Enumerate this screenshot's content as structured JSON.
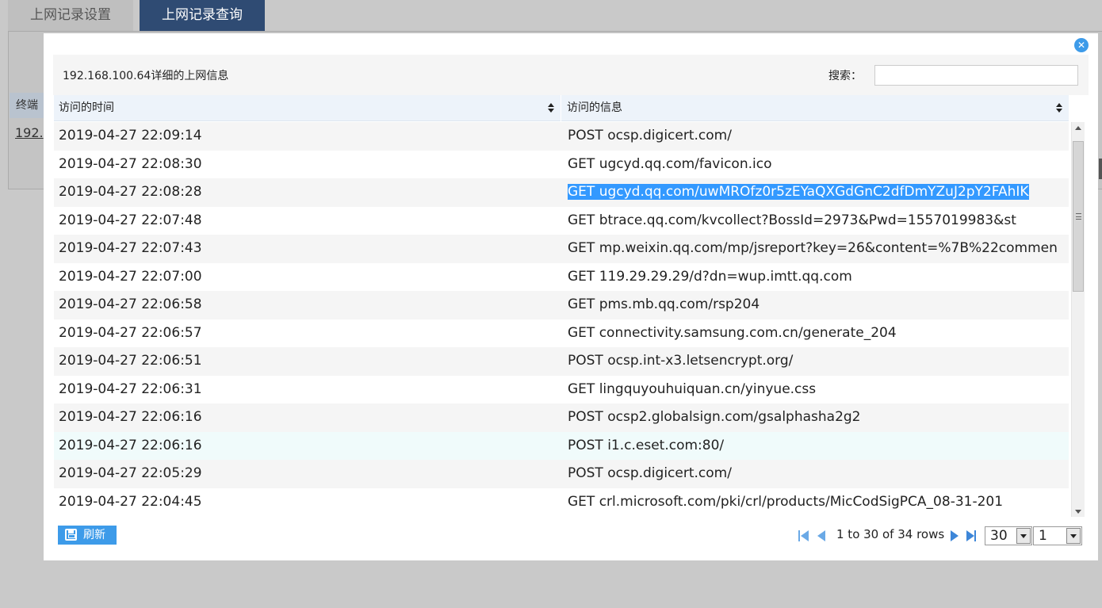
{
  "tabs": [
    {
      "label": "上网记录设置",
      "active": false
    },
    {
      "label": "上网记录查询",
      "active": true
    }
  ],
  "background": {
    "column_header": "终端",
    "ip_link": "192."
  },
  "modal": {
    "close_icon": "close-icon",
    "title": "192.168.100.64详细的上网信息",
    "search": {
      "label": "搜索：",
      "value": "",
      "placeholder": ""
    },
    "columns": [
      "访问的时间",
      "访问的信息"
    ],
    "rows": [
      {
        "time": "2019-04-27 22:09:14",
        "info": "POST ocsp.digicert.com/"
      },
      {
        "time": "2019-04-27 22:08:30",
        "info": "GET ugcyd.qq.com/favicon.ico"
      },
      {
        "time": "2019-04-27 22:08:28",
        "info": "GET ugcyd.qq.com/uwMROfz0r5zEYaQXGdGnC2dfDmYZuJ2pY2FAhIK"
      },
      {
        "time": "2019-04-27 22:07:48",
        "info": "GET btrace.qq.com/kvcollect?BossId=2973&Pwd=1557019983&st"
      },
      {
        "time": "2019-04-27 22:07:43",
        "info": "GET mp.weixin.qq.com/mp/jsreport?key=26&content=%7B%22commen"
      },
      {
        "time": "2019-04-27 22:07:00",
        "info": "GET 119.29.29.29/d?dn=wup.imtt.qq.com"
      },
      {
        "time": "2019-04-27 22:06:58",
        "info": "GET pms.mb.qq.com/rsp204"
      },
      {
        "time": "2019-04-27 22:06:57",
        "info": "GET connectivity.samsung.com.cn/generate_204"
      },
      {
        "time": "2019-04-27 22:06:51",
        "info": "POST ocsp.int-x3.letsencrypt.org/"
      },
      {
        "time": "2019-04-27 22:06:31",
        "info": "GET lingquyouhuiquan.cn/yinyue.css"
      },
      {
        "time": "2019-04-27 22:06:16",
        "info": "POST ocsp2.globalsign.com/gsalphasha2g2"
      },
      {
        "time": "2019-04-27 22:06:16",
        "info": "POST i1.c.eset.com:80/"
      },
      {
        "time": "2019-04-27 22:05:29",
        "info": "POST ocsp.digicert.com/"
      },
      {
        "time": "2019-04-27 22:04:45",
        "info": "GET crl.microsoft.com/pki/crl/products/MicCodSigPCA_08-31-201"
      }
    ],
    "selected_row_index": 2,
    "hover_row_index": 11,
    "footer": {
      "refresh_label": "刷新",
      "page_info": "1 to 30 of 34 rows",
      "page_size": "30",
      "page_number": "1"
    }
  },
  "colors": {
    "accent": "#3d9be9",
    "active_tab": "#2f4b73",
    "selection": "#3399ff"
  }
}
